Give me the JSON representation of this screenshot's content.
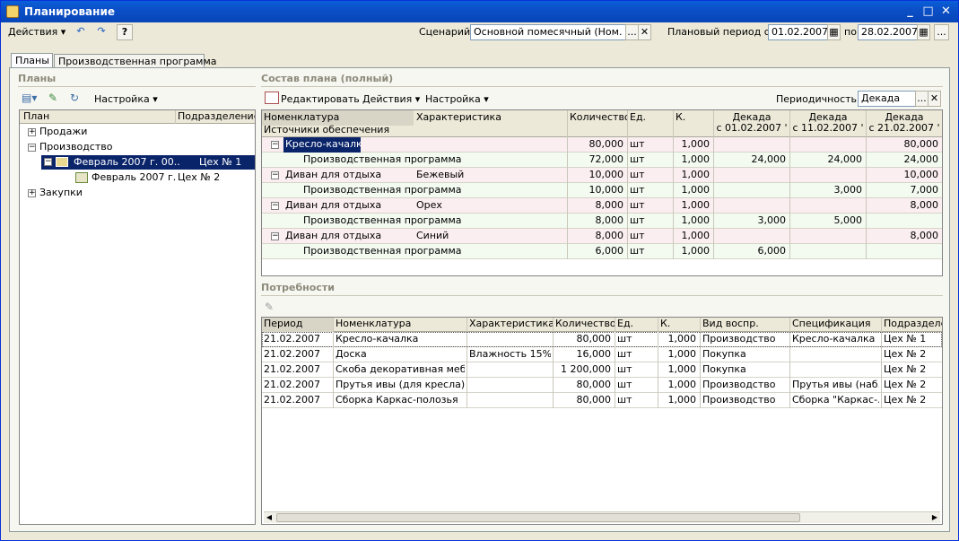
{
  "window": {
    "title": "Планирование",
    "minimize": "_",
    "maximize": "□",
    "close": "✕"
  },
  "toolbar": {
    "actions_label": "Действия ▾",
    "help_label": "?",
    "scenario_label": "Сценарий:",
    "scenario_value": "Основной помесячный (Ном. С+Х",
    "scenario_dots": "...",
    "scenario_clear": "✕",
    "period_label": "Плановый период с:",
    "period_from": "01.02.2007",
    "period_to_label": "по",
    "period_to": "28.02.2007",
    "period_dots": "..."
  },
  "tabs": [
    {
      "label": "Планы"
    },
    {
      "label": "Производственная программа"
    }
  ],
  "plans": {
    "title": "Планы",
    "settings_label": "Настройка ▾",
    "headers": [
      "План",
      "Подразделение"
    ],
    "tree": [
      {
        "label": "Продажи",
        "dept": ""
      },
      {
        "label": "Производство",
        "dept": ""
      },
      {
        "label": "Февраль 2007 г. 00...",
        "dept": "Цех № 1"
      },
      {
        "label": "Февраль 2007 г...",
        "dept": "Цех № 2"
      },
      {
        "label": "Закупки",
        "dept": ""
      }
    ]
  },
  "composition": {
    "title": "Состав плана (полный)",
    "edit_label": "Редактировать",
    "actions_label": "Действия ▾",
    "settings_label": "Настройка ▾",
    "periodicity_label": "Периодичность:",
    "periodicity_value": "Декада",
    "periodicity_dots": "...",
    "periodicity_clear": "✕",
    "headers": {
      "nomenclature": "Номенклатура",
      "sources": "Источники обеспечения",
      "characteristic": "Характеристика",
      "quantity": "Количество",
      "unit": "Ед.",
      "k": "К.",
      "d1a": "Декада",
      "d1b": "с 01.02.2007 '",
      "d2a": "Декада",
      "d2b": "с 11.02.2007 '",
      "d3a": "Декада",
      "d3b": "с 21.02.2007 '"
    },
    "rows": [
      {
        "name": "Кресло-качалка",
        "char": "",
        "qty": "80,000",
        "unit": "шт",
        "k": "1,000",
        "d1": "",
        "d2": "",
        "d3": "80,000",
        "level": 0
      },
      {
        "name": "Производственная программа",
        "char": "",
        "qty": "72,000",
        "unit": "шт",
        "k": "1,000",
        "d1": "24,000",
        "d2": "24,000",
        "d3": "24,000",
        "level": 1
      },
      {
        "name": "Диван для отдыха",
        "char": "Бежевый",
        "qty": "10,000",
        "unit": "шт",
        "k": "1,000",
        "d1": "",
        "d2": "",
        "d3": "10,000",
        "level": 0
      },
      {
        "name": "Производственная программа",
        "char": "",
        "qty": "10,000",
        "unit": "шт",
        "k": "1,000",
        "d1": "",
        "d2": "3,000",
        "d3": "7,000",
        "level": 1
      },
      {
        "name": "Диван для отдыха",
        "char": "Орех",
        "qty": "8,000",
        "unit": "шт",
        "k": "1,000",
        "d1": "",
        "d2": "",
        "d3": "8,000",
        "level": 0
      },
      {
        "name": "Производственная программа",
        "char": "",
        "qty": "8,000",
        "unit": "шт",
        "k": "1,000",
        "d1": "3,000",
        "d2": "5,000",
        "d3": "",
        "level": 1
      },
      {
        "name": "Диван для отдыха",
        "char": "Синий",
        "qty": "8,000",
        "unit": "шт",
        "k": "1,000",
        "d1": "",
        "d2": "",
        "d3": "8,000",
        "level": 0
      },
      {
        "name": "Производственная программа",
        "char": "",
        "qty": "6,000",
        "unit": "шт",
        "k": "1,000",
        "d1": "6,000",
        "d2": "",
        "d3": "",
        "level": 1
      }
    ]
  },
  "needs": {
    "title": "Потребности",
    "headers": [
      "Период",
      "Номенклатура",
      "Характеристика",
      "Количество",
      "Ед.",
      "К.",
      "Вид воспр.",
      "Спецификация",
      "Подразделен"
    ],
    "rows": [
      [
        "21.02.2007",
        "Кресло-качалка",
        "",
        "80,000",
        "шт",
        "1,000",
        "Производство",
        "Кресло-качалка",
        "Цех № 1"
      ],
      [
        "21.02.2007",
        "Доска",
        "Влажность 15%",
        "16,000",
        "шт",
        "1,000",
        "Покупка",
        "",
        "Цех № 2"
      ],
      [
        "21.02.2007",
        "Скоба декоративная мебе...",
        "",
        "1 200,000",
        "шт",
        "1,000",
        "Покупка",
        "",
        "Цех № 2"
      ],
      [
        "21.02.2007",
        "Прутья ивы (для кресла)",
        "",
        "80,000",
        "шт",
        "1,000",
        "Производство",
        "Прутья ивы (наб...",
        "Цех № 2"
      ],
      [
        "21.02.2007",
        "Сборка Каркас-полозья",
        "",
        "80,000",
        "шт",
        "1,000",
        "Производство",
        "Сборка \"Каркас-...",
        "Цех № 2"
      ]
    ]
  },
  "colors": {
    "title_bar": "#0a5fd8",
    "selected_row": "#0a246a",
    "group_row": "#fbeef0",
    "child_row": "#f3fbf1"
  }
}
